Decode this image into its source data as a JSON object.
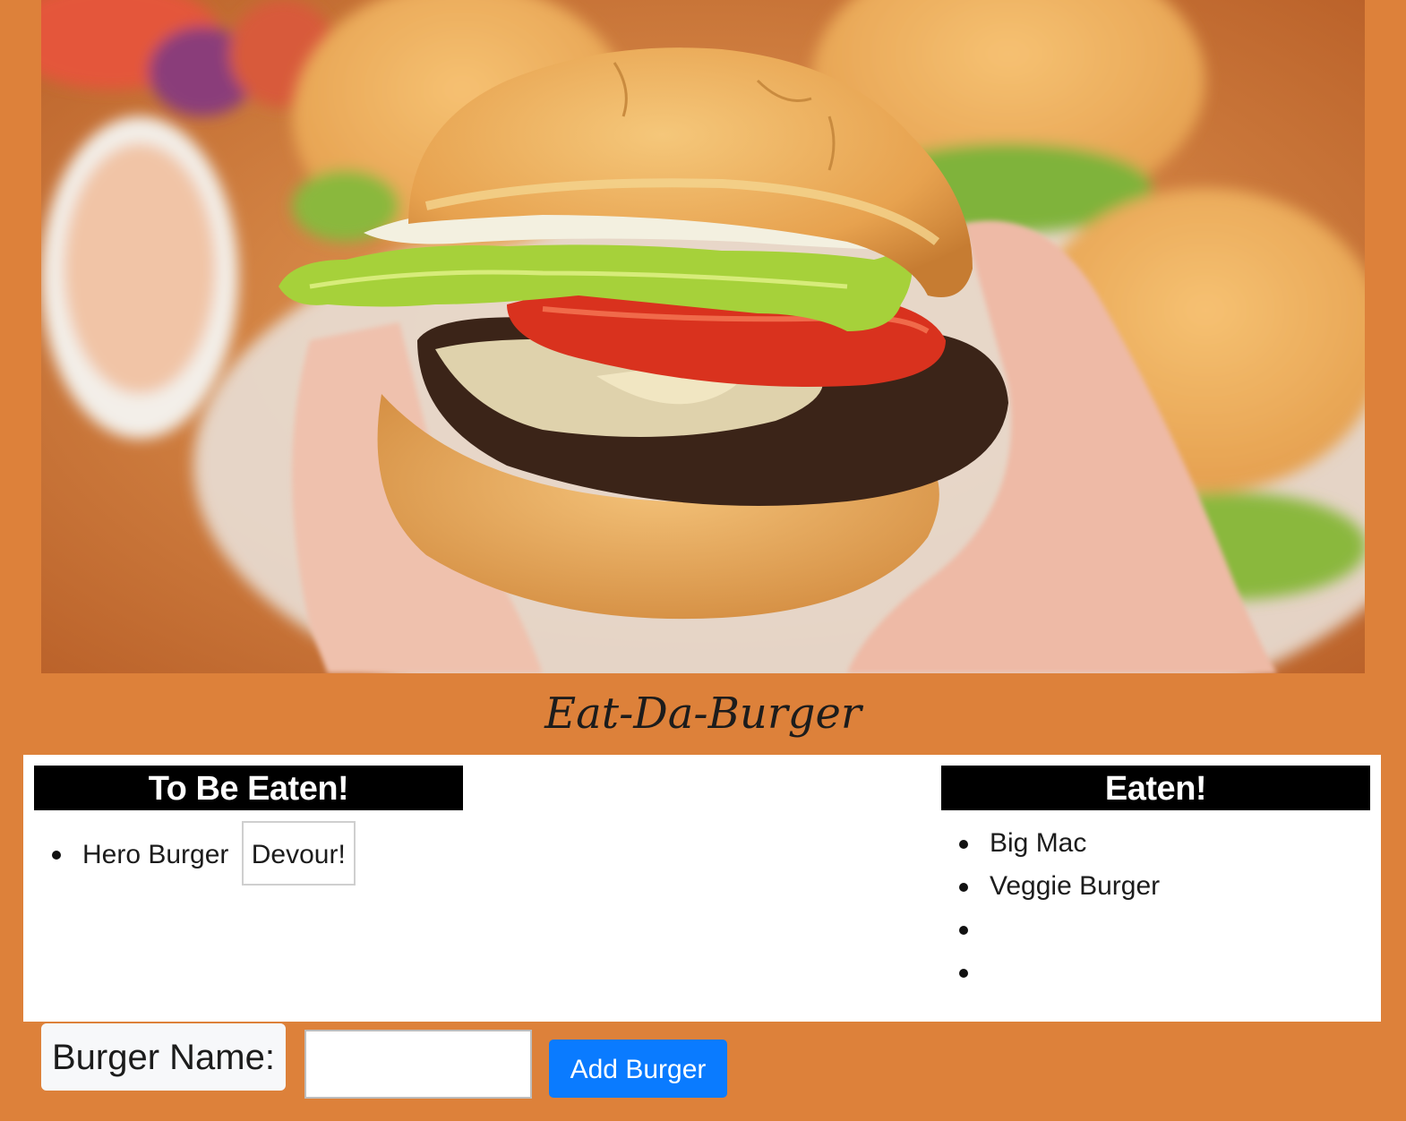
{
  "app": {
    "title": "Eat-Da-Burger"
  },
  "hero": {
    "image_subject": "burger-photo"
  },
  "to_be_eaten": {
    "heading": "To Be Eaten!",
    "items": [
      {
        "name": "Hero Burger",
        "action_label": "Devour!"
      }
    ]
  },
  "eaten": {
    "heading": "Eaten!",
    "items": [
      "Big Mac",
      "Veggie Burger",
      "",
      ""
    ]
  },
  "form": {
    "label": "Burger Name:",
    "input_value": "",
    "input_placeholder": "",
    "submit_label": "Add Burger"
  },
  "colors": {
    "page_background": "#dd813a",
    "panel_background": "#ffffff",
    "header_background": "#000000",
    "primary_button": "#0a7bff"
  }
}
